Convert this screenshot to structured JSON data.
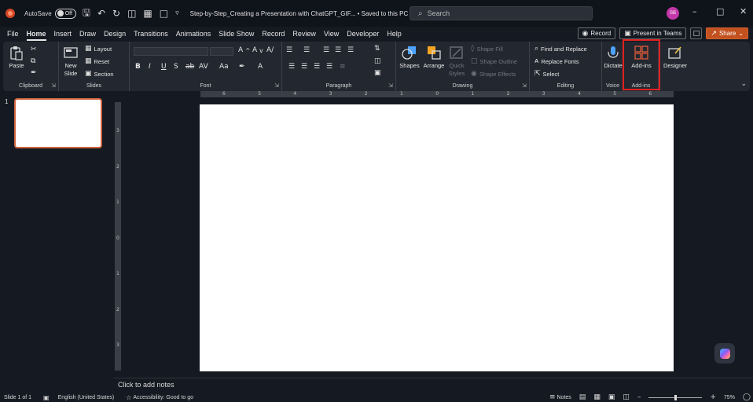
{
  "titlebar": {
    "autosave_label": "AutoSave",
    "autosave_state": "Off",
    "doc_title": "Step-by-Step_Creating a Presentation with ChatGPT_GIF...  • Saved to this PC ⌄",
    "search_placeholder": "Search",
    "avatar_initials": "SB",
    "window_controls": [
      "–",
      "□",
      "✕"
    ]
  },
  "menu": {
    "tabs": [
      "File",
      "Home",
      "Insert",
      "Draw",
      "Design",
      "Transitions",
      "Animations",
      "Slide Show",
      "Record",
      "Review",
      "View",
      "Developer",
      "Help"
    ],
    "active": "Home",
    "record_label": "Record",
    "present_label": "Present in Teams",
    "share_label": "Share"
  },
  "ribbon": {
    "clipboard": {
      "label": "Clipboard",
      "paste": "Paste"
    },
    "slides": {
      "label": "Slides",
      "new_slide": "New",
      "new_slide_2": "Slide",
      "layout": "Layout",
      "reset": "Reset",
      "section": "Section"
    },
    "font": {
      "label": "Font"
    },
    "paragraph": {
      "label": "Paragraph"
    },
    "drawing": {
      "label": "Drawing",
      "shapes": "Shapes",
      "arrange": "Arrange",
      "quick_styles": "Quick",
      "quick_styles_2": "Styles",
      "shape_fill": "Shape Fill",
      "shape_outline": "Shape Outline",
      "shape_effects": "Shape Effects"
    },
    "editing": {
      "label": "Editing",
      "find_replace": "Find and Replace",
      "replace_fonts": "Replace Fonts",
      "select": "Select"
    },
    "voice": {
      "label": "Voice",
      "dictate": "Dictate"
    },
    "addins": {
      "label": "Add-ins",
      "addins": "Add-ins"
    },
    "designer": {
      "designer": "Designer"
    }
  },
  "rulers": {
    "horizontal": [
      "6",
      "5",
      "4",
      "3",
      "2",
      "1",
      "0",
      "1",
      "2",
      "3",
      "4",
      "5",
      "6"
    ],
    "vertical": [
      "3",
      "2",
      "1",
      "0",
      "1",
      "2",
      "3"
    ]
  },
  "thumbnails": {
    "slide_number": "1"
  },
  "notes": {
    "placeholder": "Click to add notes"
  },
  "status": {
    "slide_info": "Slide 1 of 1",
    "language": "English (United States)",
    "accessibility": "Accessibility: Good to go",
    "notes_label": "Notes",
    "zoom": "75%",
    "zoom_level": 0.5
  },
  "colors": {
    "accent": "#c2511f",
    "highlight": "#e02020",
    "avatar": "#c238a8"
  }
}
